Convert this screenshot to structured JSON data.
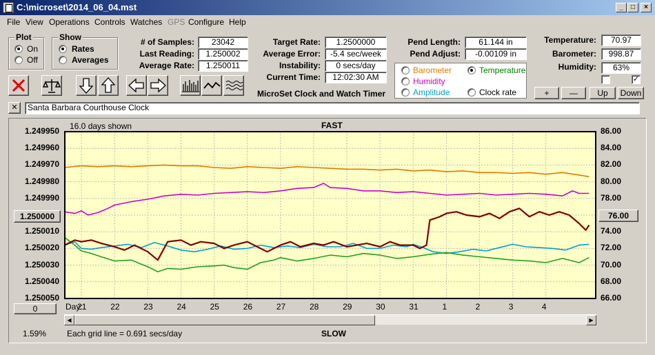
{
  "window": {
    "title": "C:\\microset\\2014_06_04.mst",
    "minimize": "_",
    "maximize": "□",
    "close": "×"
  },
  "menu": [
    "File",
    "View",
    "Operations",
    "Controls",
    "Watches",
    "GPS",
    "Configure",
    "Help"
  ],
  "plot": {
    "label": "Plot",
    "on": "On",
    "off": "Off",
    "selected": "On"
  },
  "show": {
    "label": "Show",
    "rates": "Rates",
    "averages": "Averages",
    "selected": "Rates"
  },
  "stats": {
    "samples_label": "# of Samples:",
    "samples": "23042",
    "last_label": "Last Reading:",
    "last": "1.250002",
    "avg_label": "Average Rate:",
    "avg": "1.250011",
    "target_label": "Target Rate:",
    "target": "1.2500000",
    "error_label": "Average Error:",
    "error": "-5.4 sec/week",
    "instab_label": "Instability:",
    "instab": "0 secs/day",
    "time_label": "Current Time:",
    "time": "12:02:30 AM",
    "pendlen_label": "Pend Length:",
    "pendlen": "61.144 in",
    "pendadj_label": "Pend Adjust:",
    "pendadj": "-0.00109 in",
    "temp_label": "Temperature:",
    "temp": "70.97",
    "baro_label": "Barometer:",
    "baro": "998.87",
    "hum_label": "Humidity:",
    "hum": "63%"
  },
  "app_title": "MicroSet Clock and Watch Timer",
  "sensors": {
    "barometer": "Barometer",
    "temperature": "Temperature",
    "humidity": "Humidity",
    "amplitude": "Amplitude",
    "clock_rate": "Clock rate",
    "selected": "Temperature",
    "colors": {
      "barometer": "#e07a00",
      "temperature": "#008000",
      "humidity": "#cc00cc",
      "amplitude": "#00a0c8",
      "clock_rate": "#000000"
    }
  },
  "zoom_buttons": {
    "plus": "+",
    "minus": "—",
    "up": "Up",
    "down": "Down"
  },
  "toolbar_icons": [
    "close-x-icon",
    "balance-scale-icon",
    "arrow-down-icon",
    "arrow-up-icon",
    "arrow-left-icon",
    "arrow-right-icon",
    "bar-graph-icon",
    "line-graph-icon",
    "wave-graph-icon"
  ],
  "clock": {
    "close_label": "✕",
    "name": "Santa Barbara Courthouse Clock"
  },
  "chart": {
    "days_shown": "16.0 days shown",
    "fast": "FAST",
    "slow": "SLOW",
    "center_button": "1.250000",
    "right_button": "76.00",
    "zero_button": "0",
    "percent": "1.59%",
    "grid_note": "Each grid line = 0.691 secs/day",
    "day_label": "Day:"
  },
  "chart_data": {
    "type": "line",
    "title": "FAST",
    "xlabel": "Day:",
    "x_ticks": [
      "21",
      "22",
      "23",
      "24",
      "25",
      "26",
      "27",
      "28",
      "29",
      "30",
      "31",
      "1",
      "2",
      "3",
      "4"
    ],
    "left_axis": {
      "ticks": [
        "1.249950",
        "1.249960",
        "1.249970",
        "1.249980",
        "1.249990",
        "1.250000",
        "1.250010",
        "1.250020",
        "1.250030",
        "1.250040",
        "1.250050"
      ],
      "range": [
        1.24995,
        1.25005
      ],
      "inverted": true
    },
    "right_axis": {
      "ticks": [
        "86.00",
        "84.00",
        "82.00",
        "80.00",
        "78.00",
        "76.00",
        "74.00",
        "72.00",
        "70.00",
        "68.00",
        "66.00"
      ],
      "range": [
        66,
        86
      ]
    },
    "x_range": [
      20.5,
      36.5
    ],
    "grid": true,
    "background": "#ffffc8",
    "series": [
      {
        "color": "#e07a00",
        "axis": "right",
        "points": [
          [
            20.5,
            81.7
          ],
          [
            21,
            81.9
          ],
          [
            21.5,
            81.8
          ],
          [
            22,
            81.9
          ],
          [
            22.5,
            81.8
          ],
          [
            23,
            81.9
          ],
          [
            23.5,
            82.0
          ],
          [
            24,
            81.9
          ],
          [
            24.5,
            81.9
          ],
          [
            25,
            81.7
          ],
          [
            25.5,
            81.6
          ],
          [
            26,
            81.8
          ],
          [
            26.5,
            81.7
          ],
          [
            27,
            81.6
          ],
          [
            27.5,
            81.8
          ],
          [
            28,
            81.7
          ],
          [
            28.5,
            81.6
          ],
          [
            29,
            81.5
          ],
          [
            29.5,
            81.5
          ],
          [
            30,
            81.4
          ],
          [
            30.5,
            81.5
          ],
          [
            31,
            81.3
          ],
          [
            31.5,
            81.4
          ],
          [
            32,
            81.2
          ],
          [
            32.5,
            81.3
          ],
          [
            33,
            81.1
          ],
          [
            33.5,
            81.1
          ],
          [
            34,
            81.0
          ],
          [
            34.5,
            81.1
          ],
          [
            35,
            80.9
          ],
          [
            35.5,
            81.1
          ],
          [
            36,
            80.8
          ],
          [
            36.3,
            80.6
          ]
        ]
      },
      {
        "color": "#cc00cc",
        "axis": "right",
        "points": [
          [
            20.5,
            76.4
          ],
          [
            20.8,
            76.2
          ],
          [
            21,
            76.5
          ],
          [
            21.2,
            76.0
          ],
          [
            21.5,
            76.3
          ],
          [
            21.8,
            76.8
          ],
          [
            22,
            77.2
          ],
          [
            22.5,
            77.6
          ],
          [
            23,
            77.9
          ],
          [
            23.5,
            78.3
          ],
          [
            24,
            78.5
          ],
          [
            24.5,
            78.4
          ],
          [
            25,
            78.6
          ],
          [
            25.5,
            78.7
          ],
          [
            26,
            78.8
          ],
          [
            26.5,
            78.7
          ],
          [
            27,
            78.9
          ],
          [
            27.5,
            79.2
          ],
          [
            28,
            79.3
          ],
          [
            28.3,
            79.8
          ],
          [
            28.5,
            79.3
          ],
          [
            29,
            79.2
          ],
          [
            29.5,
            78.9
          ],
          [
            30,
            78.9
          ],
          [
            30.5,
            78.7
          ],
          [
            31,
            78.8
          ],
          [
            31.5,
            78.6
          ],
          [
            32,
            78.4
          ],
          [
            32.5,
            78.5
          ],
          [
            33,
            78.6
          ],
          [
            33.5,
            78.4
          ],
          [
            34,
            78.5
          ],
          [
            34.5,
            78.6
          ],
          [
            35,
            78.5
          ],
          [
            35.5,
            78.3
          ],
          [
            35.8,
            78.9
          ],
          [
            36,
            78.6
          ],
          [
            36.3,
            78.6
          ]
        ]
      },
      {
        "color": "#00a0c8",
        "axis": "right",
        "points": [
          [
            20.5,
            72.4
          ],
          [
            20.8,
            72.8
          ],
          [
            21,
            72.0
          ],
          [
            21.3,
            71.9
          ],
          [
            21.6,
            72.1
          ],
          [
            22,
            72.3
          ],
          [
            22.4,
            72.5
          ],
          [
            22.8,
            72.1
          ],
          [
            23.2,
            72.7
          ],
          [
            23.6,
            72.3
          ],
          [
            24,
            71.8
          ],
          [
            24.4,
            71.6
          ],
          [
            24.8,
            71.9
          ],
          [
            25.2,
            72.3
          ],
          [
            25.6,
            71.9
          ],
          [
            26,
            72.0
          ],
          [
            26.4,
            72.4
          ],
          [
            26.8,
            72.1
          ],
          [
            27.2,
            72.3
          ],
          [
            27.6,
            72.1
          ],
          [
            28,
            72.5
          ],
          [
            28.4,
            72.2
          ],
          [
            28.8,
            72.2
          ],
          [
            29.2,
            72.6
          ],
          [
            29.6,
            72.0
          ],
          [
            30,
            72.0
          ],
          [
            30.4,
            72.4
          ],
          [
            30.8,
            72.2
          ],
          [
            31,
            72.5
          ],
          [
            31.3,
            72.1
          ],
          [
            31.6,
            71.6
          ],
          [
            32,
            71.4
          ],
          [
            32.4,
            71.6
          ],
          [
            32.8,
            71.9
          ],
          [
            33.2,
            71.7
          ],
          [
            33.6,
            72.1
          ],
          [
            34,
            72.5
          ],
          [
            34.4,
            72.2
          ],
          [
            34.8,
            72.1
          ],
          [
            35.2,
            72.0
          ],
          [
            35.6,
            71.8
          ],
          [
            36,
            72.4
          ],
          [
            36.3,
            72.5
          ]
        ]
      },
      {
        "color": "#20a020",
        "axis": "right",
        "points": [
          [
            20.5,
            73.3
          ],
          [
            20.8,
            72.4
          ],
          [
            21,
            71.7
          ],
          [
            21.3,
            71.4
          ],
          [
            21.6,
            71.0
          ],
          [
            22,
            70.5
          ],
          [
            22.5,
            70.6
          ],
          [
            23,
            69.8
          ],
          [
            23.3,
            69.2
          ],
          [
            23.6,
            69.6
          ],
          [
            24,
            69.5
          ],
          [
            24.5,
            69.8
          ],
          [
            25,
            69.9
          ],
          [
            25.3,
            70.0
          ],
          [
            25.6,
            69.7
          ],
          [
            26,
            69.5
          ],
          [
            26.4,
            70.3
          ],
          [
            26.8,
            70.6
          ],
          [
            27,
            70.9
          ],
          [
            27.5,
            70.5
          ],
          [
            28,
            70.8
          ],
          [
            28.5,
            71.2
          ],
          [
            29,
            71.0
          ],
          [
            29.5,
            71.4
          ],
          [
            30,
            71.2
          ],
          [
            30.5,
            70.8
          ],
          [
            31,
            71.0
          ],
          [
            31.5,
            71.3
          ],
          [
            32,
            71.5
          ],
          [
            32.5,
            71.2
          ],
          [
            33,
            71.0
          ],
          [
            33.5,
            70.8
          ],
          [
            34,
            70.6
          ],
          [
            34.5,
            70.5
          ],
          [
            35,
            70.3
          ],
          [
            35.5,
            70.8
          ],
          [
            36,
            70.3
          ],
          [
            36.3,
            70.9
          ]
        ]
      },
      {
        "color": "#800000",
        "axis": "left",
        "points": [
          [
            20.5,
            1.250018
          ],
          [
            20.8,
            1.250015
          ],
          [
            21,
            1.250016
          ],
          [
            21.3,
            1.250015
          ],
          [
            21.6,
            1.250017
          ],
          [
            22,
            1.250019
          ],
          [
            22.3,
            1.250021
          ],
          [
            22.6,
            1.250018
          ],
          [
            23,
            1.250022
          ],
          [
            23.3,
            1.250027
          ],
          [
            23.6,
            1.250016
          ],
          [
            24,
            1.250015
          ],
          [
            24.3,
            1.250018
          ],
          [
            24.6,
            1.250016
          ],
          [
            25,
            1.250017
          ],
          [
            25.3,
            1.25002
          ],
          [
            25.6,
            1.250018
          ],
          [
            26,
            1.250016
          ],
          [
            26.3,
            1.250019
          ],
          [
            26.6,
            1.250022
          ],
          [
            27,
            1.250018
          ],
          [
            27.3,
            1.250016
          ],
          [
            27.6,
            1.250019
          ],
          [
            28,
            1.250017
          ],
          [
            28.3,
            1.250018
          ],
          [
            28.6,
            1.250016
          ],
          [
            29,
            1.250019
          ],
          [
            29.3,
            1.250018
          ],
          [
            29.6,
            1.250017
          ],
          [
            30,
            1.250019
          ],
          [
            30.3,
            1.250016
          ],
          [
            30.6,
            1.250018
          ],
          [
            31,
            1.250018
          ],
          [
            31.2,
            1.25002
          ],
          [
            31.4,
            1.250018
          ],
          [
            31.5,
            1.250003
          ],
          [
            31.8,
            1.250001
          ],
          [
            32,
            1.249999
          ],
          [
            32.3,
            1.249998
          ],
          [
            32.6,
            1.25
          ],
          [
            33,
            1.250001
          ],
          [
            33.3,
            1.249999
          ],
          [
            33.6,
            1.250002
          ],
          [
            33.9,
            1.249998
          ],
          [
            34.2,
            1.249996
          ],
          [
            34.5,
            1.250001
          ],
          [
            34.8,
            1.249998
          ],
          [
            35.1,
            1.25
          ],
          [
            35.4,
            1.249998
          ],
          [
            35.7,
            1.25
          ],
          [
            36,
            1.250005
          ],
          [
            36.2,
            1.250009
          ],
          [
            36.3,
            1.250006
          ]
        ]
      }
    ]
  }
}
